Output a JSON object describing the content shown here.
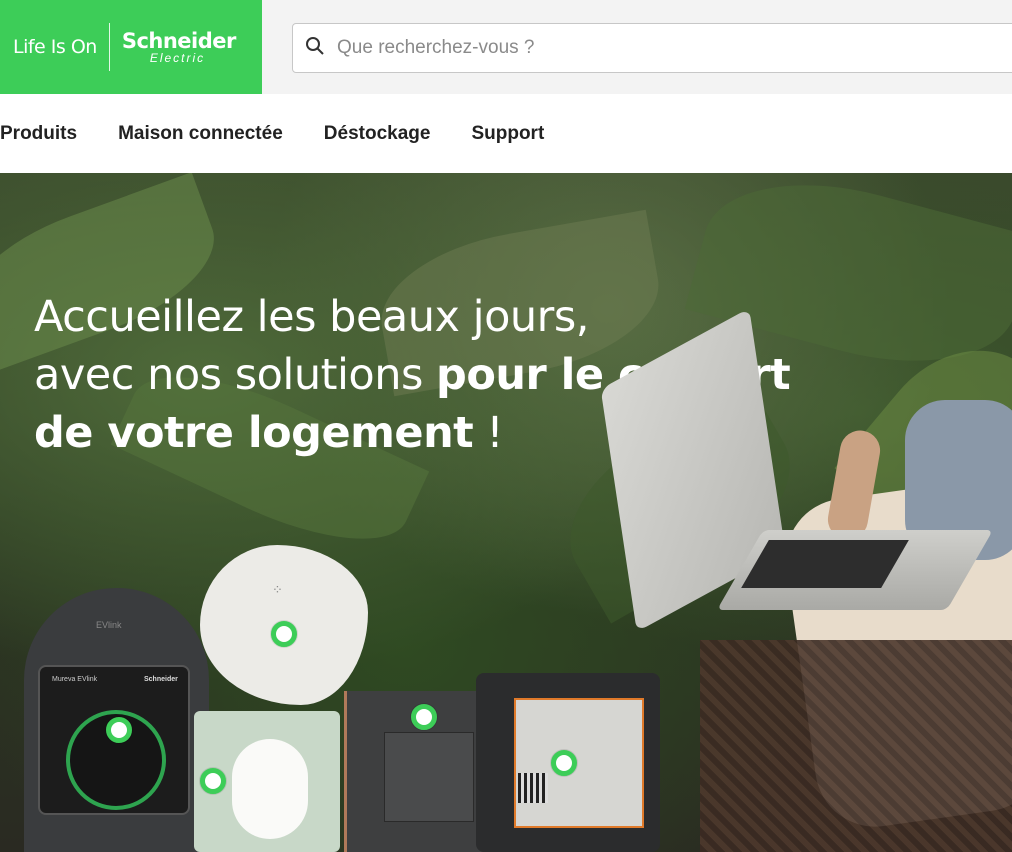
{
  "brand": {
    "tagline": "Life Is On",
    "name": "Schneider",
    "sub": "Electric",
    "accent_color": "#3dcd58"
  },
  "search": {
    "placeholder": "Que recherchez-vous ?",
    "icon": "search-icon"
  },
  "nav": {
    "items": [
      {
        "label": "Produits"
      },
      {
        "label": "Maison connectée"
      },
      {
        "label": "Déstockage"
      },
      {
        "label": "Support"
      }
    ]
  },
  "hero": {
    "line1": "Accueillez les beaux jours,",
    "line2_regular": "avec nos solutions ",
    "line2_bold": "pour le confort",
    "line3_bold": "de votre logement",
    "line3_regular": " !"
  },
  "products": {
    "ev_label": "EVlink",
    "ev_screen_label": "Mureva EVlink",
    "ev_screen_brand": "Schneider"
  }
}
